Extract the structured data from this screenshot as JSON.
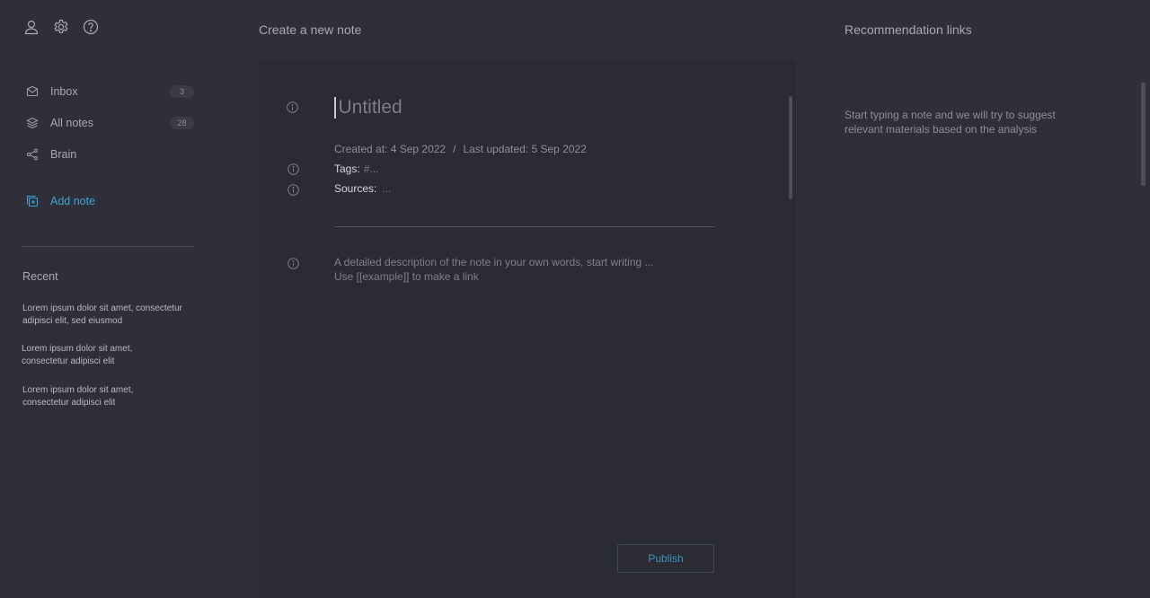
{
  "sidebar": {
    "top_icons": [
      "user-icon",
      "settings-icon",
      "help-icon"
    ],
    "nav_items": [
      {
        "label": "Inbox",
        "badge": "3",
        "icon": "inbox-icon"
      },
      {
        "label": "All notes",
        "badge": "28",
        "icon": "layers-icon"
      },
      {
        "label": "Brain",
        "badge": "",
        "icon": "share-graph-icon"
      }
    ],
    "add_note_label": "Add note",
    "recent_title": "Recent",
    "recent_items": [
      "Lorem ipsum dolor sit amet, consectetur adipisci elit, sed eiusmod",
      "Lorem ipsum dolor sit amet, consectetur adipisci elit",
      "Lorem ipsum dolor sit amet, consectetur adipisci elit"
    ]
  },
  "editor": {
    "page_title": "Create a new note",
    "title_placeholder": "Untitled",
    "created_at": "Created at: 4 Sep 2022",
    "separator": "/",
    "last_updated": "Last updated: 5 Sep 2022",
    "tags_label": "Tags:",
    "tags_placeholder": "#...",
    "sources_label": "Sources:",
    "sources_placeholder": "...",
    "description_line1": "A detailed description of the note in your own words, start writing ...",
    "description_line2": "Use [[example]] to make a link",
    "publish_label": "Publish"
  },
  "recommendations": {
    "title": "Recommendation links",
    "empty_text": "Start typing a note and we will try to suggest relevant materials based on the analysis"
  },
  "colors": {
    "background": "#2e2f38",
    "editor_background": "#2a2b33",
    "accent": "#3da4d2"
  }
}
